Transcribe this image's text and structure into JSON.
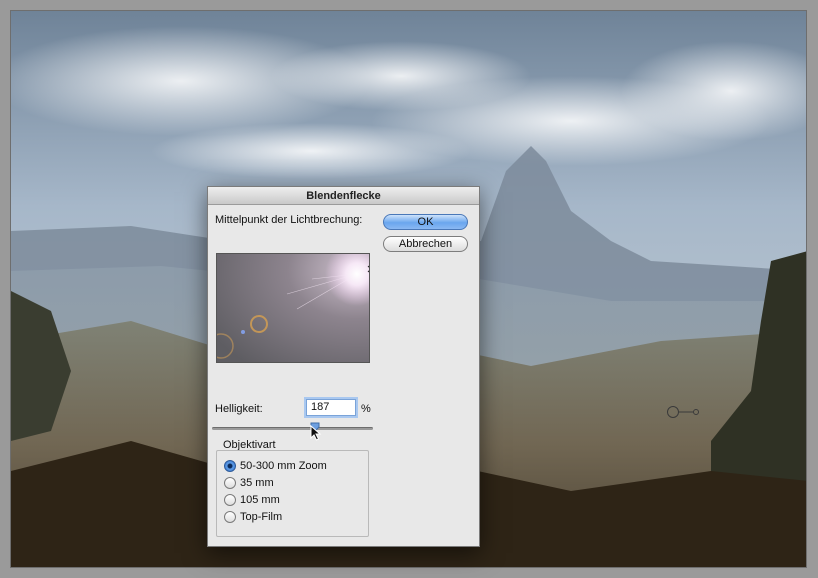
{
  "dialog": {
    "title": "Blendenflecke",
    "center_label": "Mittelpunkt der Lichtbrechung:",
    "ok_label": "OK",
    "cancel_label": "Abbrechen",
    "brightness_label": "Helligkeit:",
    "brightness_value": "187",
    "brightness_unit": "%",
    "brightness_slider_fraction": 0.64,
    "lens_group_label": "Objektivart",
    "lens_options": [
      {
        "label": "50-300 mm Zoom",
        "checked": true
      },
      {
        "label": "35 mm",
        "checked": false
      },
      {
        "label": "105 mm",
        "checked": false
      },
      {
        "label": "Top-Film",
        "checked": false
      }
    ]
  },
  "colors": {
    "ok_button": "#6aa6ee",
    "dialog_bg": "#e8e8e8",
    "focus_ring": "#a9c8f0"
  },
  "icons": {
    "cursor": "arrow-cursor-icon",
    "flare_center_marker": "crosshair-icon"
  }
}
